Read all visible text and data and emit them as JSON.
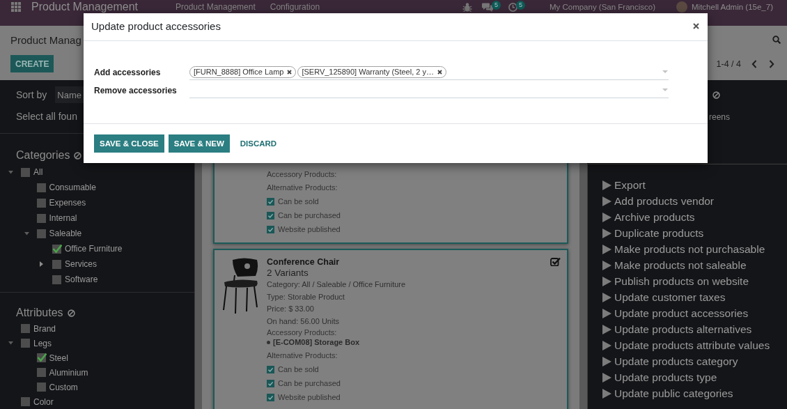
{
  "navbar": {
    "app_name": "Product Management",
    "menu": [
      "Product Management",
      "Configuration"
    ],
    "messages_badge": "5",
    "activities_badge": "5",
    "company": "My Company (San Francisco)",
    "user": "Mitchell Admin (15e_7)"
  },
  "control_panel": {
    "breadcrumb": "Product Manag",
    "create_button": "CREATE",
    "pager": "1-4 / 4"
  },
  "sidebar": {
    "sort_label": "Sort by",
    "sort_value": "Name",
    "select_all": "Select all foun",
    "filters": [
      {
        "title": "Categories",
        "items": [
          {
            "label": "All",
            "checked": false,
            "expanded": true,
            "children": [
              {
                "label": "Consumable",
                "checked": false
              },
              {
                "label": "Expenses",
                "checked": false
              },
              {
                "label": "Internal",
                "checked": false
              },
              {
                "label": "Saleable",
                "checked": false,
                "expanded": true,
                "children": [
                  {
                    "label": "Office Furniture",
                    "checked": true
                  },
                  {
                    "label": "Services",
                    "checked": false,
                    "expanded": false
                  },
                  {
                    "label": "Software",
                    "checked": false
                  }
                ]
              }
            ]
          }
        ]
      },
      {
        "title": "Attributes",
        "items": [
          {
            "label": "Brand",
            "checked": false
          },
          {
            "label": "Legs",
            "checked": false,
            "expanded": true,
            "children": [
              {
                "label": "Steel",
                "checked": true
              },
              {
                "label": "Aluminium",
                "checked": false
              },
              {
                "label": "Custom",
                "checked": false
              }
            ]
          },
          {
            "label": "Color",
            "checked": false
          }
        ]
      }
    ]
  },
  "kanban": {
    "cards": [
      {
        "selected": true,
        "sections": [
          {
            "label": "Accessory Products:"
          },
          {
            "label": "Alternative Products:"
          }
        ],
        "flags": [
          {
            "label": "Can be sold",
            "checked": true
          },
          {
            "label": "Can be purchased",
            "checked": true
          },
          {
            "label": "Website published",
            "checked": true
          }
        ]
      },
      {
        "selected": true,
        "title": "Conference Chair",
        "variants": "2 Variants",
        "details": [
          "Category: All / Saleable / Office Furniture",
          "Type: Storable Product",
          "Price: $ 33.00",
          "On hand: 56.00 Units"
        ],
        "sections": [
          {
            "label": "Accessory Products:",
            "items": [
              "[E-COM08] Storage Box"
            ]
          },
          {
            "label": "Alternative Products:"
          }
        ],
        "flags": [
          {
            "label": "Can be sold",
            "checked": true
          },
          {
            "label": "Can be purchased",
            "checked": true
          },
          {
            "label": "Website published",
            "checked": true
          }
        ]
      }
    ]
  },
  "right_panel": {
    "filter_text": "reens",
    "actions": [
      "Export",
      "Add products vendor",
      "Archive products",
      "Duplicate products",
      "Make products not purchasable",
      "Make products not saleable",
      "Publish products on website",
      "Update customer taxes",
      "Update product accessories",
      "Update products alternatives",
      "Update products attribute values",
      "Update products category",
      "Update products type",
      "Update public categories"
    ]
  },
  "dialog": {
    "title": "Update product accessories",
    "fields": [
      {
        "label": "Add accessories",
        "tags": [
          "[FURN_8888] Office Lamp",
          "[SERV_125890] Warranty (Steel, 2 y…"
        ]
      },
      {
        "label": "Remove accessories"
      }
    ],
    "buttons": [
      {
        "label": "SAVE & CLOSE",
        "kind": "primary"
      },
      {
        "label": "SAVE & NEW",
        "kind": "primary"
      },
      {
        "label": "DISCARD",
        "kind": "link"
      }
    ]
  }
}
